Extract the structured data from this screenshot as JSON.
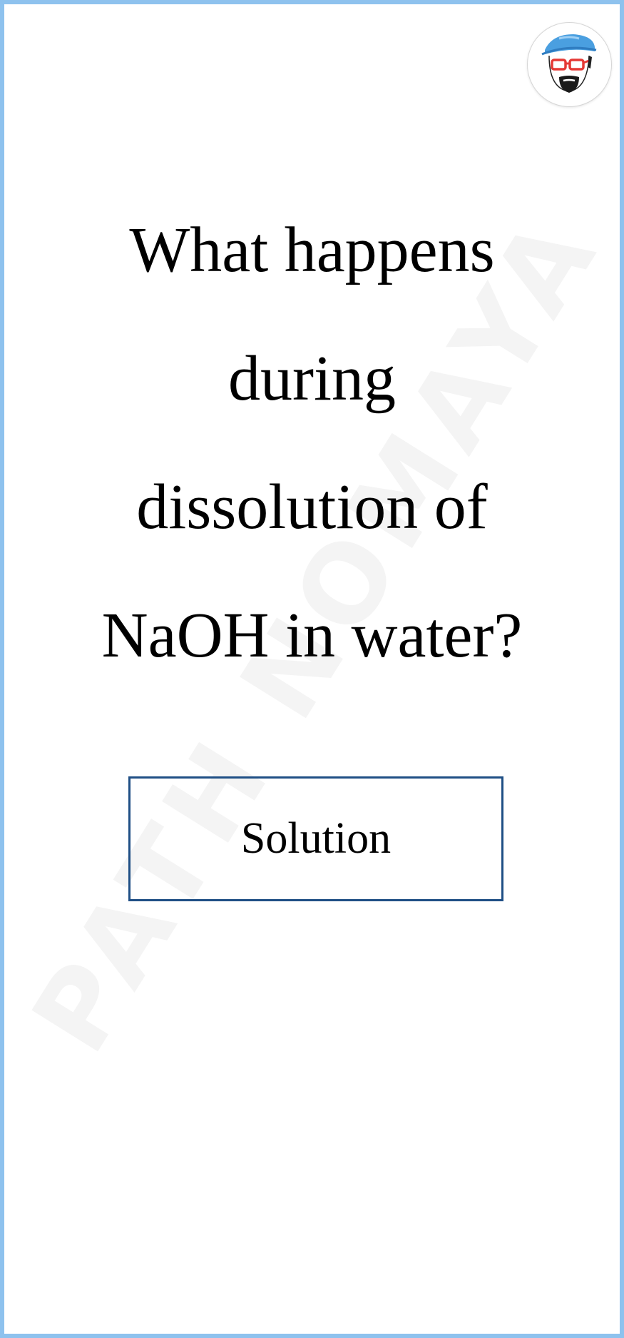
{
  "question": {
    "lines": [
      "What happens",
      "during",
      "dissolution of",
      "NaOH in water?"
    ]
  },
  "solution_button": {
    "label": "Solution"
  },
  "watermark": {
    "text": "PATH NOMAYA"
  },
  "avatar": {
    "icon": "cartoon-face-with-cap-and-glasses-icon"
  },
  "colors": {
    "frame_border": "#8ec2ee",
    "button_border": "#1f4f85",
    "text": "#000000",
    "cap": "#4a9fe0",
    "glasses": "#e53935"
  }
}
